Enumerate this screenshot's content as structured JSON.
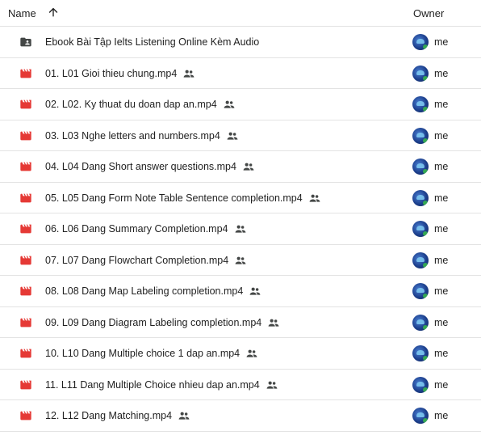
{
  "header": {
    "name_label": "Name",
    "owner_label": "Owner",
    "sort_icon": "arrow-upward-icon"
  },
  "colors": {
    "video_icon": "#e53935",
    "folder_icon": "#444746",
    "divider": "#e3e3e3",
    "text": "#1f1f1f"
  },
  "rows": [
    {
      "type": "shared-folder",
      "name": "Ebook Bài Tập Ielts Listening Online Kèm Audio",
      "shared": false,
      "owner": "me"
    },
    {
      "type": "video",
      "name": "01. L01 Gioi thieu chung.mp4",
      "shared": true,
      "owner": "me"
    },
    {
      "type": "video",
      "name": "02. L02. Ky thuat du doan dap an.mp4",
      "shared": true,
      "owner": "me"
    },
    {
      "type": "video",
      "name": "03. L03 Nghe letters and numbers.mp4",
      "shared": true,
      "owner": "me"
    },
    {
      "type": "video",
      "name": "04. L04 Dang Short answer questions.mp4",
      "shared": true,
      "owner": "me"
    },
    {
      "type": "video",
      "name": "05. L05 Dang Form Note Table Sentence completion.mp4",
      "shared": true,
      "owner": "me"
    },
    {
      "type": "video",
      "name": "06. L06 Dang Summary Completion.mp4",
      "shared": true,
      "owner": "me"
    },
    {
      "type": "video",
      "name": "07. L07 Dang Flowchart Completion.mp4",
      "shared": true,
      "owner": "me"
    },
    {
      "type": "video",
      "name": "08. L08 Dang Map Labeling completion.mp4",
      "shared": true,
      "owner": "me"
    },
    {
      "type": "video",
      "name": "09. L09 Dang Diagram Labeling completion.mp4",
      "shared": true,
      "owner": "me"
    },
    {
      "type": "video",
      "name": "10. L10 Dang Multiple choice 1 dap an.mp4",
      "shared": true,
      "owner": "me"
    },
    {
      "type": "video",
      "name": "11. L11 Dang Multiple Choice nhieu dap an.mp4",
      "shared": true,
      "owner": "me"
    },
    {
      "type": "video",
      "name": "12. L12 Dang Matching.mp4",
      "shared": true,
      "owner": "me"
    }
  ]
}
